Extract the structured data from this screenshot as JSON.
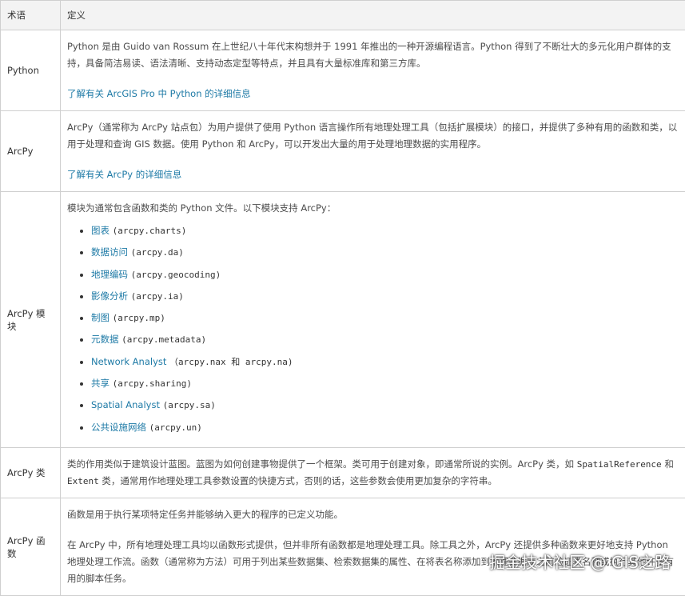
{
  "header": {
    "term": "术语",
    "definition": "定义"
  },
  "rows": {
    "python": {
      "term": "Python",
      "text": "Python 是由 Guido van Rossum 在上世纪八十年代末构想并于 1991 年推出的一种开源编程语言。Python 得到了不断壮大的多元化用户群体的支持，具备简洁易读、语法清晰、支持动态定型等特点，并且具有大量标准库和第三方库。",
      "link": "了解有关 ArcGIS Pro 中 Python 的详细信息"
    },
    "arcpy": {
      "term": "ArcPy",
      "text": "ArcPy（通常称为 ArcPy 站点包）为用户提供了使用 Python 语言操作所有地理处理工具（包括扩展模块）的接口，并提供了多种有用的函数和类，以用于处理和查询 GIS 数据。使用 Python 和 ArcPy，可以开发出大量的用于处理地理数据的实用程序。",
      "link": "了解有关 ArcPy 的详细信息"
    },
    "modules": {
      "term": "ArcPy 模块",
      "intro": "模块为通常包含函数和类的 Python 文件。以下模块支持 ArcPy：",
      "items": [
        {
          "name": "图表",
          "code": "(arcpy.charts)"
        },
        {
          "name": "数据访问",
          "code": "(arcpy.da)"
        },
        {
          "name": "地理编码",
          "code": "(arcpy.geocoding)"
        },
        {
          "name": "影像分析",
          "code": "(arcpy.ia)"
        },
        {
          "name": "制图",
          "code": "(arcpy.mp)"
        },
        {
          "name": "元数据",
          "code": "(arcpy.metadata)"
        },
        {
          "name": "Network Analyst",
          "code": "（arcpy.nax 和 arcpy.na)"
        },
        {
          "name": "共享",
          "code": "(arcpy.sharing)"
        },
        {
          "name": "Spatial Analyst",
          "code": "(arcpy.sa)"
        },
        {
          "name": "公共设施网络",
          "code": "(arcpy.un)"
        }
      ]
    },
    "classes": {
      "term": "ArcPy 类",
      "text1": "类的作用类似于建筑设计蓝图。蓝图为如何创建事物提供了一个框架。类可用于创建对象，即通常所说的实例。ArcPy 类，如",
      "code1": "SpatialReference",
      "text2": "和",
      "code2": "Extent",
      "text3": "类，通常用作地理处理工具参数设置的快捷方式，否则的话，这些参数会使用更加复杂的字符串。"
    },
    "functions": {
      "term": "ArcPy 函数",
      "text1": "函数是用于执行某项特定任务并能够纳入更大的程序的已定义功能。",
      "text2": "在 ArcPy 中，所有地理处理工具均以函数形式提供，但并非所有函数都是地理处理工具。除工具之外，ArcPy 还提供多种函数来更好地支持 Python 地理处理工作流。函数（通常称为方法）可用于列出某些数据集、检索数据集的属性、在将表名称添加到地理数据库之前验证表名称或执行其他许多有用的脚本任务。"
    }
  },
  "watermark": "掘金技术社区 @ GIS之路"
}
